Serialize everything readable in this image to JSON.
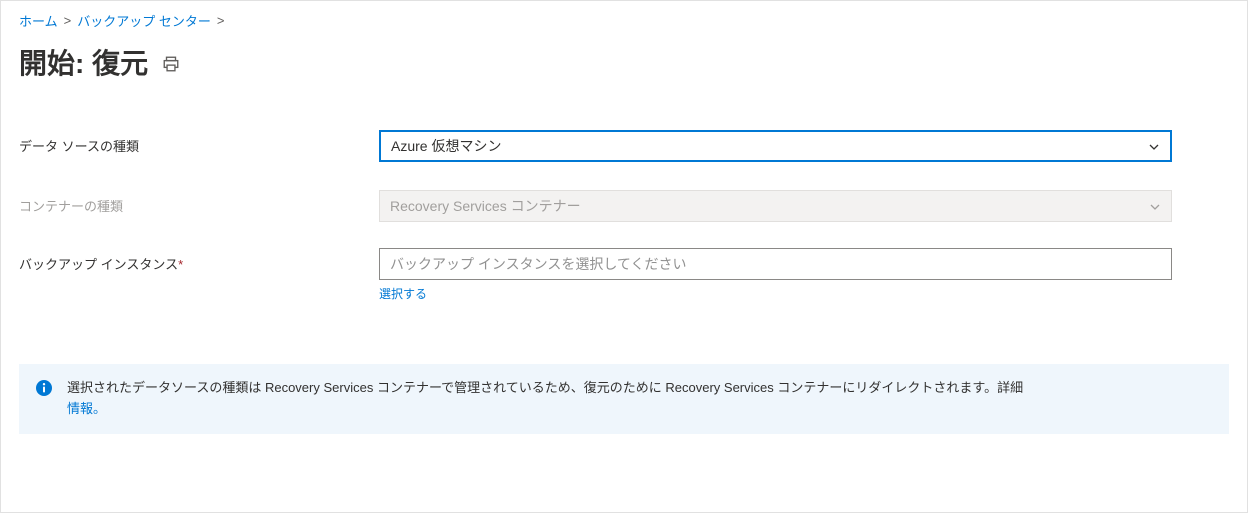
{
  "breadcrumb": {
    "home": "ホーム",
    "backup_center": "バックアップ センター"
  },
  "page_title": "開始: 復元",
  "form": {
    "datasource_type": {
      "label": "データ ソースの種類",
      "value": "Azure 仮想マシン"
    },
    "vault_type": {
      "label": "コンテナーの種類",
      "value": "Recovery Services コンテナー"
    },
    "backup_instance": {
      "label": "バックアップ インスタンス",
      "placeholder": "バックアップ インスタンスを選択してください",
      "help_link": "選択する"
    }
  },
  "info_banner": {
    "text": "選択されたデータソースの種類は Recovery Services コンテナーで管理されているため、復元のために Recovery Services コンテナーにリダイレクトされます。詳細",
    "link": "情報。"
  }
}
